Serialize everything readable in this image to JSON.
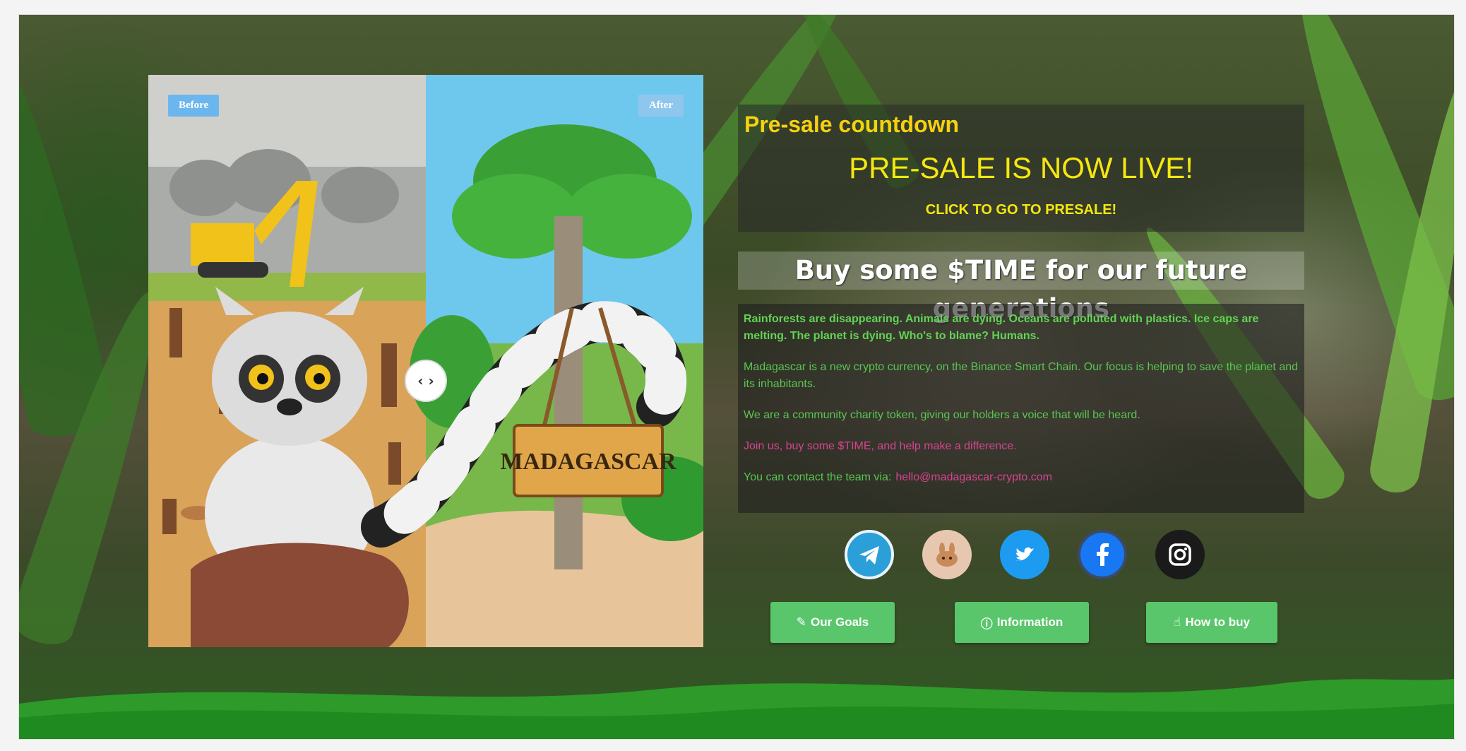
{
  "compare": {
    "before_label": "Before",
    "after_label": "After",
    "sign_text": "MADAGASCAR",
    "handle_glyph": "‹ ›"
  },
  "countdown": {
    "title": "Pre-sale countdown",
    "status": "PRE-SALE IS NOW LIVE!",
    "cta": "CLICK TO GO TO PRESALE!"
  },
  "buy": {
    "title": "Buy some $TIME for our future generations"
  },
  "description": {
    "p1": "Rainforests are disappearing.  Animals are dying. Oceans are polluted with plastics.  Ice caps are melting.  The planet is dying.  Who's to blame? Humans.",
    "p2": "Madagascar is a new crypto currency, on the Binance Smart Chain.  Our focus is helping to save the planet and its inhabitants.",
    "p3": "We are a community charity token, giving our holders a voice that will be heard.",
    "p4": "Join us, buy some $TIME, and help make a difference.",
    "p5_label": "You can contact the team via:",
    "p5_email": "hello@madagascar-crypto.com"
  },
  "socials": [
    "telegram-icon",
    "pancakeswap-icon",
    "twitter-icon",
    "facebook-icon",
    "instagram-icon"
  ],
  "buttons": {
    "goals": "Our Goals",
    "info": "Information",
    "howto": "How to buy"
  },
  "colors": {
    "countdown_text": "#f5e70f",
    "green_text": "#59c552",
    "pink_text": "#d8438f",
    "button": "#5ac66b"
  }
}
